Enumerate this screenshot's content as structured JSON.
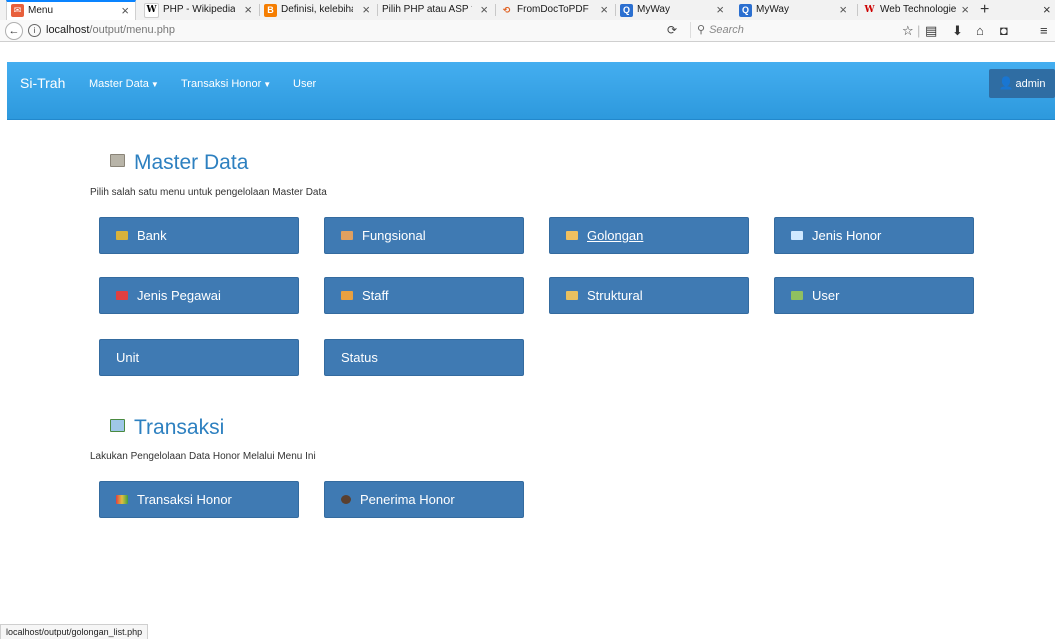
{
  "browser": {
    "tabs": [
      {
        "title": "Menu",
        "favicon_color": "#e8603c",
        "favicon_glyph": "✉",
        "active": true
      },
      {
        "title": "PHP - Wikipedia",
        "favicon_color": "#ffffff",
        "favicon_glyph": "W",
        "active": false
      },
      {
        "title": "Definisi, kelebihan",
        "favicon_color": "#f57d00",
        "favicon_glyph": "B",
        "active": false
      },
      {
        "title": "Pilih PHP atau ASP ?",
        "favicon_color": "",
        "favicon_glyph": "",
        "active": false
      },
      {
        "title": "FromDocToPDF",
        "favicon_color": "#ffffff",
        "favicon_glyph": "⟲",
        "active": false
      },
      {
        "title": "MyWay",
        "favicon_color": "#2b6fd0",
        "favicon_glyph": "Q",
        "active": false
      },
      {
        "title": "MyWay",
        "favicon_color": "#2b6fd0",
        "favicon_glyph": "Q",
        "active": false
      },
      {
        "title": "Web Technologie",
        "favicon_color": "#ffffff",
        "favicon_glyph": "W",
        "active": false
      }
    ],
    "close_glyph": "×",
    "new_tab_glyph": "+",
    "url_host": "localhost",
    "url_path": "/output/menu.php",
    "search_placeholder": "Search",
    "toolbar_icons": [
      "star-icon",
      "reading-list-icon",
      "download-icon",
      "home-icon",
      "pocket-icon",
      "hamburger-menu-icon"
    ]
  },
  "app": {
    "brand": "Si-Trah",
    "menus": [
      {
        "label": "Master Data",
        "dropdown": true
      },
      {
        "label": "Transaksi Honor",
        "dropdown": true
      },
      {
        "label": "User",
        "dropdown": false
      }
    ],
    "user_button": "admin",
    "accent_color": "#3aa3e8",
    "tile_color": "#3f7ab3",
    "title_color": "#2d80c0"
  },
  "sections": [
    {
      "title": "Master Data",
      "description": "Pilih salah satu menu untuk pengelolaan Master Data",
      "icon": "building-icon",
      "tiles": [
        {
          "label": "Bank",
          "icon": "bank-icon",
          "icon_color": "#d9b23a"
        },
        {
          "label": "Fungsional",
          "icon": "people-icon",
          "icon_color": "#e0a060"
        },
        {
          "label": "Golongan",
          "icon": "person-icon",
          "icon_color": "#f0c060",
          "hovered": true
        },
        {
          "label": "Jenis Honor",
          "icon": "folder-icon",
          "icon_color": "#cfe8ff"
        },
        {
          "label": "Jenis Pegawai",
          "icon": "envelope-icon",
          "icon_color": "#e04040"
        },
        {
          "label": "Staff",
          "icon": "staff-icon",
          "icon_color": "#e8a040"
        },
        {
          "label": "Struktural",
          "icon": "key-icon",
          "icon_color": "#e8c060"
        },
        {
          "label": "User",
          "icon": "user-card-icon",
          "icon_color": "#90c060"
        },
        {
          "label": "Unit",
          "icon": "",
          "icon_color": ""
        },
        {
          "label": "Status",
          "icon": "",
          "icon_color": ""
        }
      ]
    },
    {
      "title": "Transaksi",
      "description": "Lakukan Pengelolaan Data Honor Melalui Menu Ini",
      "icon": "cash-register-icon",
      "tiles": [
        {
          "label": "Transaksi Honor",
          "icon": "chart-icon",
          "icon_color": "#e0c040"
        },
        {
          "label": "Penerima Honor",
          "icon": "receiver-icon",
          "icon_color": "#5a4030"
        }
      ]
    }
  ],
  "status_bar": "localhost/output/golongan_list.php"
}
